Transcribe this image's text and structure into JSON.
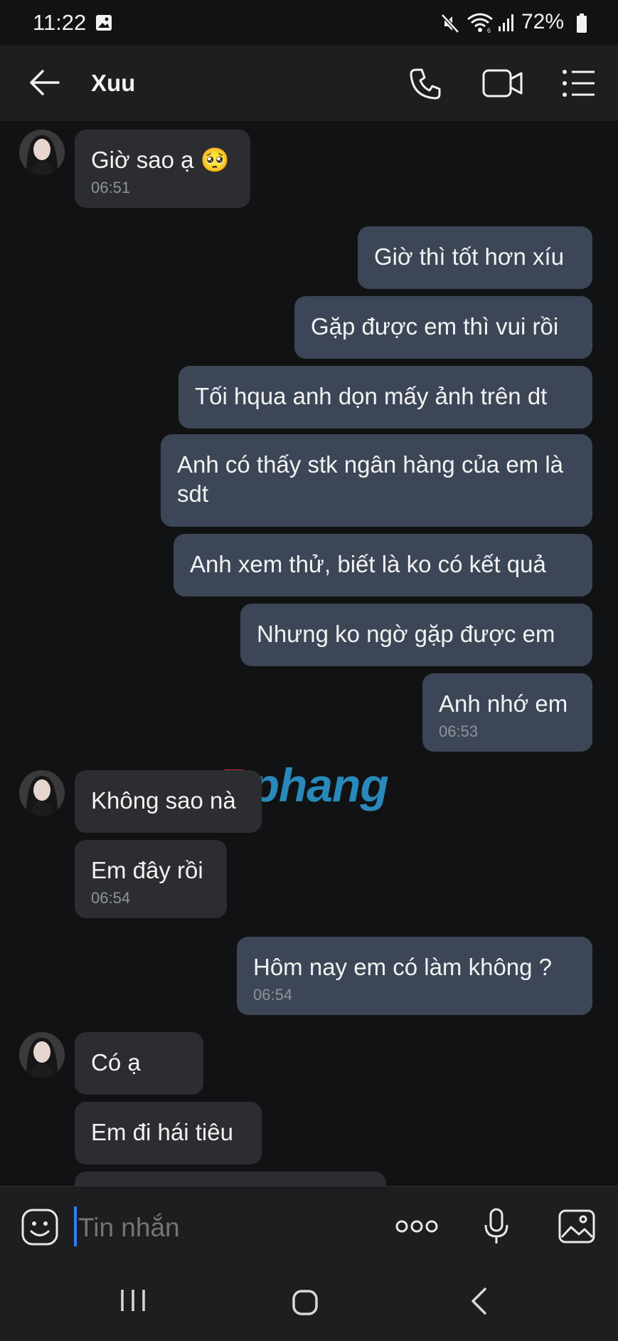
{
  "status_bar": {
    "time": "11:22",
    "battery": "72%",
    "icons": [
      "gallery-icon",
      "mute-icon",
      "wifi-icon",
      "signal-icon",
      "battery-icon"
    ]
  },
  "header": {
    "contact_name": "Xuu",
    "icons": [
      "back-arrow-icon",
      "phone-call-icon",
      "video-call-icon",
      "menu-icon"
    ]
  },
  "messages": [
    {
      "side": "in",
      "text": "Giờ sao ạ 🥺",
      "time": "06:51"
    },
    {
      "side": "out",
      "text": "Giờ thì tốt hơn xíu"
    },
    {
      "side": "out",
      "text": "Gặp được em thì vui rồi"
    },
    {
      "side": "out",
      "text": "Tối hqua anh dọn mấy ảnh trên dt"
    },
    {
      "side": "out",
      "text": "Anh có thấy stk ngân hàng của em là sdt"
    },
    {
      "side": "out",
      "text": "Anh xem thử, biết là ko có kết quả"
    },
    {
      "side": "out",
      "text": "Nhưng ko ngờ gặp được em"
    },
    {
      "side": "out",
      "text": "Anh nhớ em",
      "time": "06:53"
    },
    {
      "side": "in",
      "text": "Không sao nà"
    },
    {
      "side": "in",
      "text": "Em đây rồi",
      "time": "06:54"
    },
    {
      "side": "out",
      "text": "Hôm nay em có làm không ?",
      "time": "06:54"
    },
    {
      "side": "in",
      "text": "Có ạ"
    },
    {
      "side": "in",
      "text": "Em đi hái tiêu"
    }
  ],
  "watermark": {
    "first": "R",
    "rest": "phang"
  },
  "input": {
    "placeholder": "Tin nhắn"
  },
  "colors": {
    "background": "#111213",
    "bar": "#1d1e20",
    "incoming_bubble": "#2c2d30",
    "outgoing_bubble": "#3c4656",
    "timestamp": "#8f939b",
    "cursor": "#2d7ff9"
  }
}
